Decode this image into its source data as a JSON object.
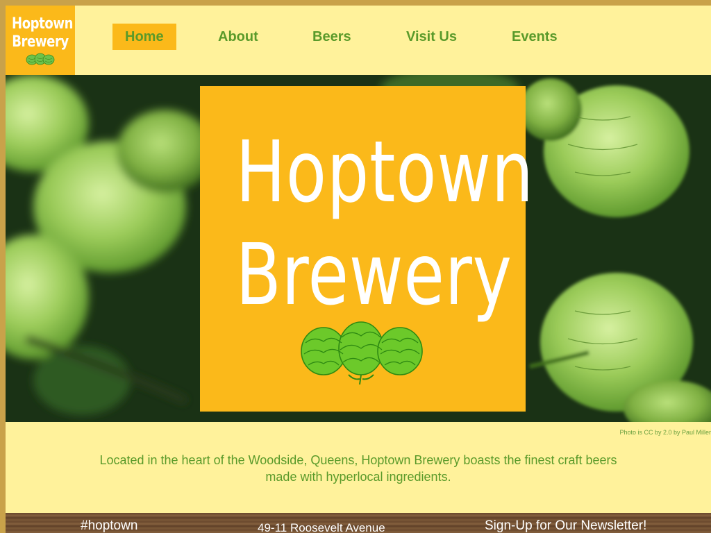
{
  "brand": {
    "logo_line1": "Hoptown",
    "logo_line2": "Brewery",
    "accent_color": "#fbb91a",
    "background_color": "#fff29b",
    "text_green": "#5a9a2a"
  },
  "nav": {
    "items": [
      {
        "label": "Home",
        "active": true
      },
      {
        "label": "About",
        "active": false
      },
      {
        "label": "Beers",
        "active": false
      },
      {
        "label": "Visit Us",
        "active": false
      },
      {
        "label": "Events",
        "active": false
      }
    ]
  },
  "hero": {
    "title_line1": "Hoptown",
    "title_line2": "Brewery",
    "icon": "hops-icon",
    "photo_credit": "Photo is CC by 2.0 by Paul Miller"
  },
  "intro": {
    "line1": "Located in the heart of the Woodside, Queens, Hoptown Brewery boasts the finest craft beers",
    "line2": "made with hyperlocal ingredients."
  },
  "footer": {
    "hashtag": "#hoptown",
    "address": "49-11 Roosevelt Avenue",
    "newsletter": "Sign-Up for Our Newsletter!"
  }
}
